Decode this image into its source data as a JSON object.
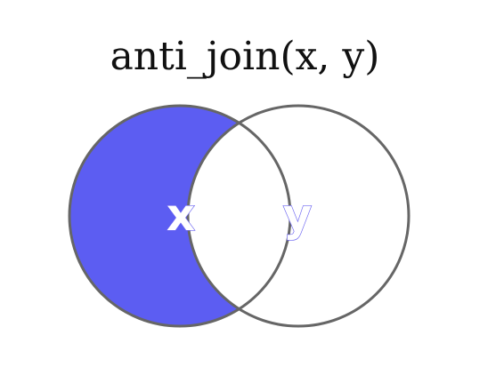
{
  "diagram": {
    "title": "anti_join(x, y)",
    "sets": [
      {
        "id": "x",
        "label": "x"
      },
      {
        "id": "y",
        "label": "y"
      }
    ],
    "highlighted_region": "x-only",
    "colors": {
      "highlight_fill": "#5c5df2",
      "outline": "#666666",
      "background": "#ffffff",
      "title": "#111111",
      "label_x_fill": "#ffffff",
      "label_y_fill": "#ffffff",
      "label_outline": "#6a63f1"
    }
  }
}
